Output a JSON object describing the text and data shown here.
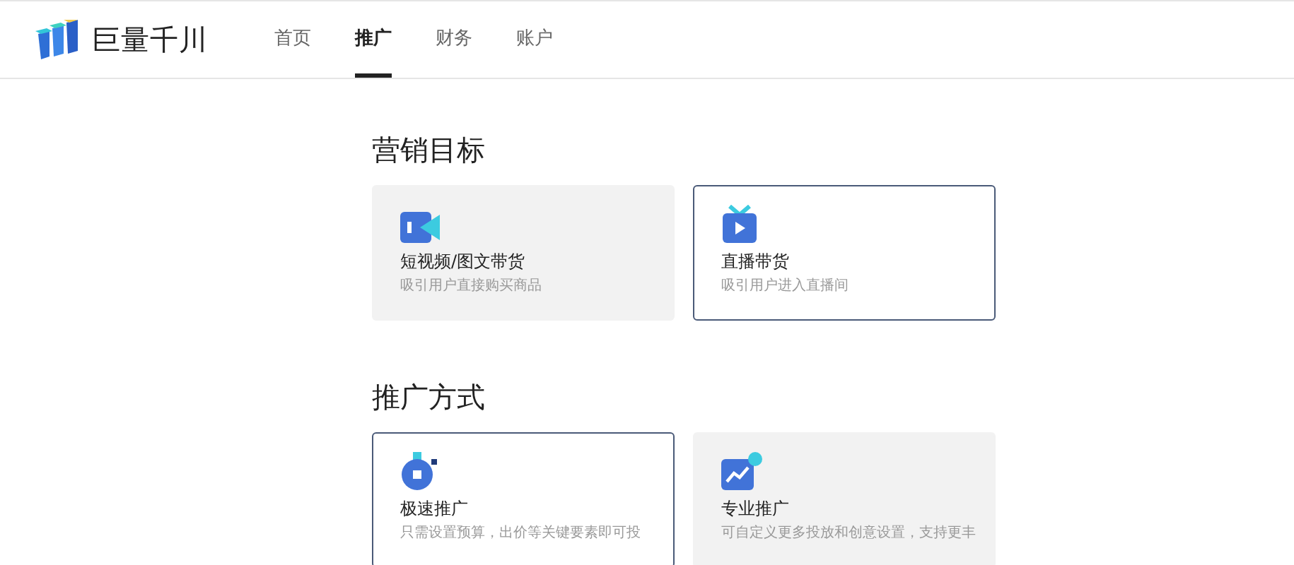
{
  "logo": {
    "text": "巨量千川"
  },
  "nav": [
    {
      "label": "首页",
      "selected": false
    },
    {
      "label": "推广",
      "selected": true
    },
    {
      "label": "财务",
      "selected": false
    },
    {
      "label": "账户",
      "selected": false
    }
  ],
  "sections": [
    {
      "title": "营销目标",
      "cards": [
        {
          "kind": "video",
          "title": "短视频/图文带货",
          "description": "吸引用户直接购买商品",
          "selected": false
        },
        {
          "kind": "live",
          "title": "直播带货",
          "description": "吸引用户进入直播间",
          "selected": true
        }
      ]
    },
    {
      "title": "推广方式",
      "cards": [
        {
          "kind": "speed",
          "title": "极速推广",
          "description": "只需设置预算，出价等关键要素即可投",
          "selected": true
        },
        {
          "kind": "pro",
          "title": "专业推广",
          "description": "可自定义更多投放和创意设置，支持更丰",
          "selected": false
        }
      ]
    }
  ]
}
